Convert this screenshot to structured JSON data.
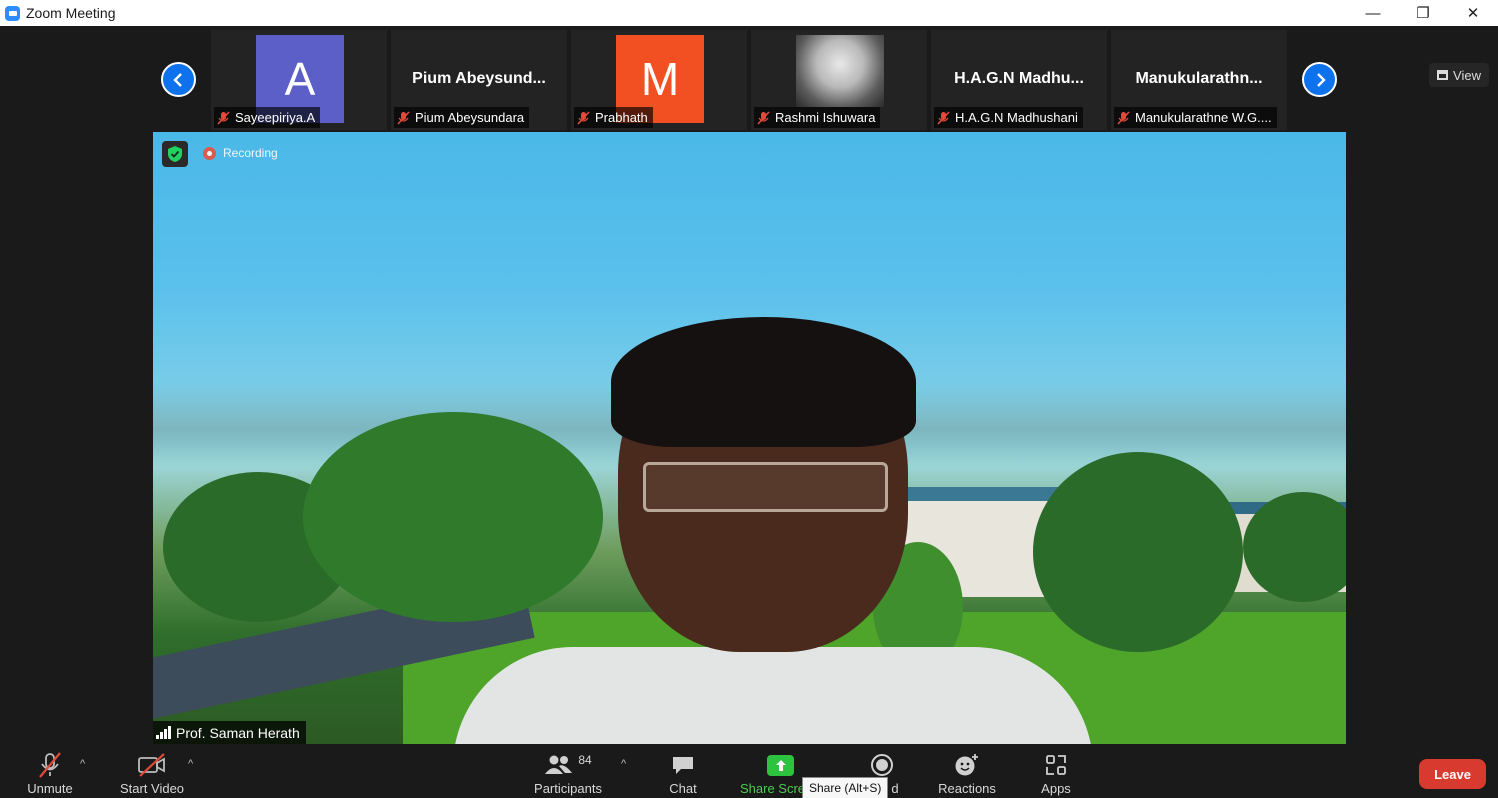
{
  "window": {
    "title": "Zoom Meeting",
    "controls": {
      "minimize": "—",
      "restore": "❐",
      "close": "✕"
    }
  },
  "view_button": {
    "label": "View"
  },
  "participants_strip": [
    {
      "name": "Sayeepiriya.A",
      "avatar_letter": "A",
      "avatar_color": "#5b5fc7",
      "muted": true
    },
    {
      "name": "Pium Abeysundara",
      "display_name": "Pium  Abeysund...",
      "muted": true
    },
    {
      "name": "Prabhath",
      "avatar_letter": "M",
      "avatar_color": "#f25022",
      "muted": true
    },
    {
      "name": "Rashmi Ishuwara",
      "avatar": "photo",
      "muted": true
    },
    {
      "name": "H.A.G.N Madhushani",
      "display_name": "H.A.G.N  Madhu...",
      "muted": true
    },
    {
      "name": "Manukularathne W.G....",
      "display_name": "Manukularathn...",
      "muted": true
    }
  ],
  "main_video": {
    "recording_label": "Recording",
    "speaker_name": "Prof. Saman Herath"
  },
  "toolbar": {
    "unmute": "Unmute",
    "start_video": "Start Video",
    "participants": "Participants",
    "participants_count": "84",
    "chat": "Chat",
    "share_screen": "Share Scre",
    "share_tooltip": "Share (Alt+S)",
    "record_tail": "d",
    "reactions": "Reactions",
    "apps": "Apps",
    "leave": "Leave"
  },
  "colors": {
    "accent_blue": "#0e72ed",
    "share_green": "#2ec33f",
    "leave_red": "#d93a2f",
    "mute_red": "#e04b3a"
  }
}
